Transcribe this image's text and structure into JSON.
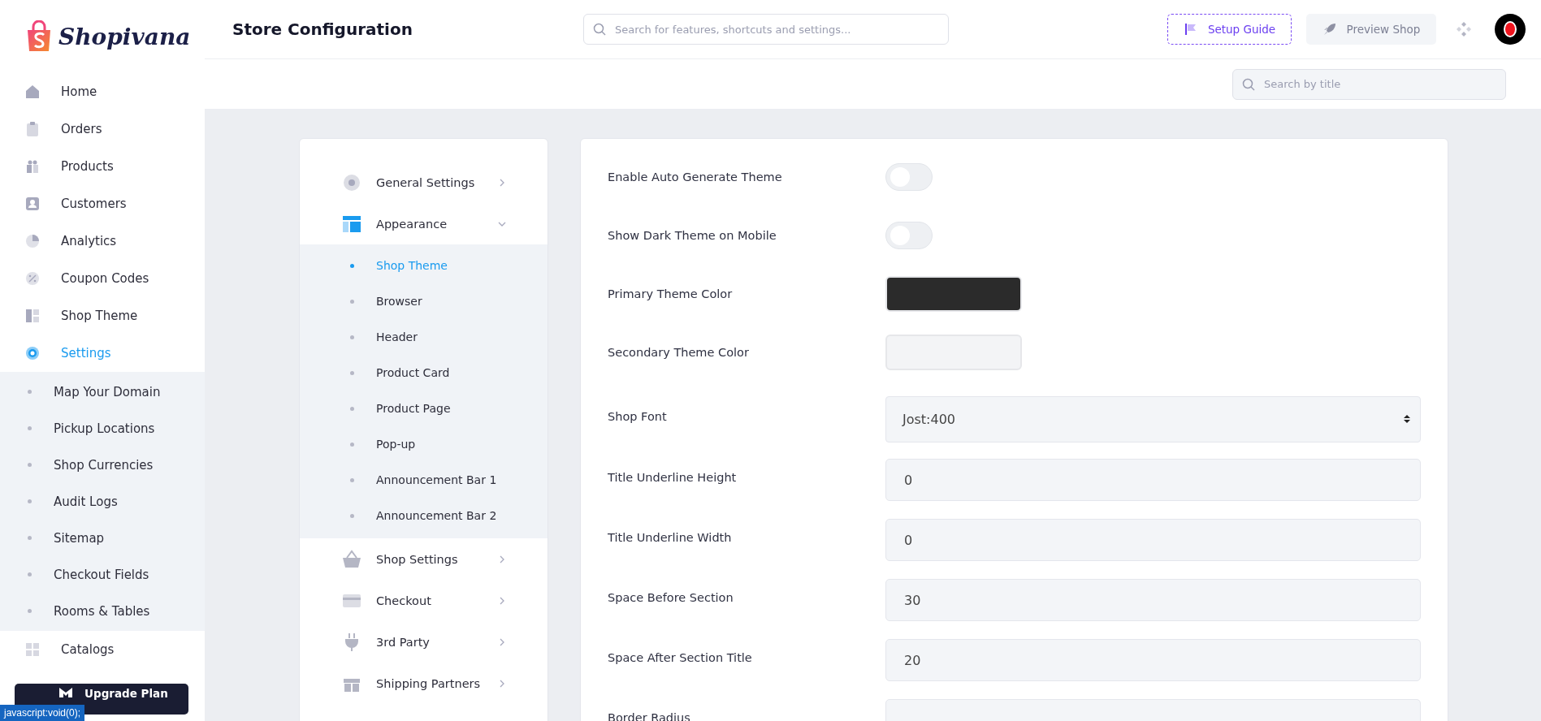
{
  "logo": {
    "name": "Shopivana"
  },
  "sidebar": {
    "items": [
      {
        "label": "Home",
        "selected": false
      },
      {
        "label": "Orders",
        "selected": false
      },
      {
        "label": "Products",
        "selected": false
      },
      {
        "label": "Customers",
        "selected": false
      },
      {
        "label": "Analytics",
        "selected": false
      },
      {
        "label": "Coupon Codes",
        "selected": false
      },
      {
        "label": "Shop Theme",
        "selected": false
      },
      {
        "label": "Settings",
        "selected": true,
        "expanded": true,
        "children": [
          {
            "label": "Map Your Domain"
          },
          {
            "label": "Pickup Locations"
          },
          {
            "label": "Shop Currencies"
          },
          {
            "label": "Audit Logs"
          },
          {
            "label": "Sitemap"
          },
          {
            "label": "Checkout Fields"
          },
          {
            "label": "Rooms & Tables"
          }
        ]
      },
      {
        "label": "Catalogs",
        "selected": false
      }
    ],
    "upgrade_button": "Upgrade Plan"
  },
  "status_link": "javascript:void(0);",
  "header": {
    "title": "Store Configuration",
    "search": {
      "placeholder": "Search for features, shortcuts and settings..."
    },
    "setup_button": "Setup Guide",
    "preview_button": "Preview Shop"
  },
  "subheader": {
    "search": {
      "placeholder": "Search by title"
    }
  },
  "settings_menu": [
    {
      "label": "General Settings",
      "expanded": false
    },
    {
      "label": "Appearance",
      "expanded": true,
      "children": [
        {
          "label": "Shop Theme",
          "selected": true
        },
        {
          "label": "Browser",
          "selected": false
        },
        {
          "label": "Header",
          "selected": false
        },
        {
          "label": "Product Card",
          "selected": false
        },
        {
          "label": "Product Page",
          "selected": false
        },
        {
          "label": "Pop-up",
          "selected": false
        },
        {
          "label": "Announcement Bar 1",
          "selected": false
        },
        {
          "label": "Announcement Bar 2",
          "selected": false
        }
      ]
    },
    {
      "label": "Shop Settings",
      "expanded": false
    },
    {
      "label": "Checkout",
      "expanded": false
    },
    {
      "label": "3rd Party",
      "expanded": false
    },
    {
      "label": "Shipping Partners",
      "expanded": false
    }
  ],
  "form": [
    {
      "kind": "toggle",
      "label": "Enable Auto Generate Theme",
      "on": false
    },
    {
      "kind": "toggle",
      "label": "Show Dark Theme on Mobile",
      "on": false
    },
    {
      "kind": "color",
      "label": "Primary Theme Color",
      "color": "#2b2b2b"
    },
    {
      "kind": "color",
      "label": "Secondary Theme Color",
      "color": "#f3f4f6"
    },
    {
      "kind": "select",
      "label": "Shop Font",
      "value": "Jost:400"
    },
    {
      "kind": "input",
      "label": "Title Underline Height",
      "value": "0"
    },
    {
      "kind": "input",
      "label": "Title Underline Width",
      "value": "0"
    },
    {
      "kind": "input",
      "label": "Space Before Section",
      "value": "30"
    },
    {
      "kind": "input",
      "label": "Space After Section Title",
      "value": "20"
    },
    {
      "kind": "input",
      "label": "Border Radius"
    }
  ]
}
